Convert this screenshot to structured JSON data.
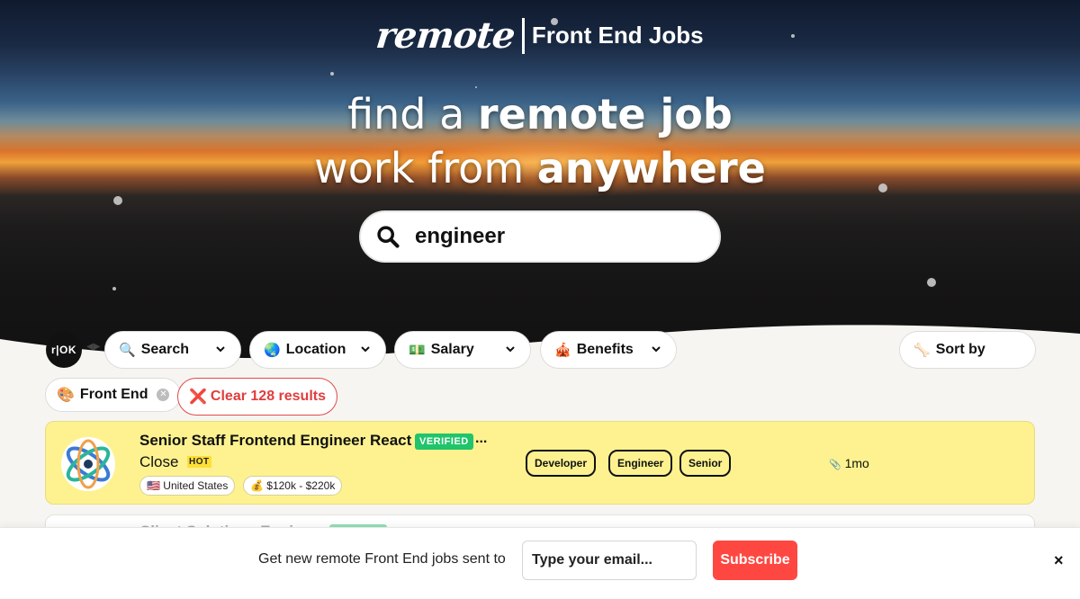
{
  "brand": {
    "logo_script": "remote",
    "logo_subtitle": "Front End Jobs"
  },
  "hero": {
    "line1_light": "find a ",
    "line1_bold": "remote job",
    "line2_light": "work from ",
    "line2_bold": "anywhere",
    "search_value": "engineer",
    "search_icon": "search-icon"
  },
  "filters": {
    "rok_label": "r|OK",
    "items": [
      {
        "icon": "🔍",
        "label": "Search"
      },
      {
        "icon": "🌏",
        "label": "Location"
      },
      {
        "icon": "💵",
        "label": "Salary"
      },
      {
        "icon": "🎪",
        "label": "Benefits"
      }
    ],
    "sort": {
      "icon": "🦴",
      "label": "Sort by"
    }
  },
  "active_chips": {
    "tag_icon": "🎨",
    "tag_label": "Front End",
    "clear_icon": "❌",
    "clear_label": "Clear 128 results"
  },
  "jobs": [
    {
      "title": "Senior Staff Frontend Engineer React",
      "verified_badge": "VERIFIED",
      "title_more": "...",
      "company": "Close",
      "hot_badge": "HOT",
      "location": "🇺🇸 United States",
      "salary": "💰 $120k - $220k",
      "tags": [
        "Developer",
        "Engineer",
        "Senior"
      ],
      "age_icon": "📎",
      "age": "1mo"
    },
    {
      "title": "Client Solutions Engineer"
    }
  ],
  "subscribe": {
    "text": "Get new remote Front End jobs sent to",
    "email_placeholder": "Type your email...",
    "button_label": "Subscribe",
    "close_label": "×"
  },
  "colors": {
    "card_highlight": "#fdf28f",
    "verified_green": "#21c46b",
    "subscribe_red": "#ff4742",
    "clear_red": "#e03d3d"
  }
}
